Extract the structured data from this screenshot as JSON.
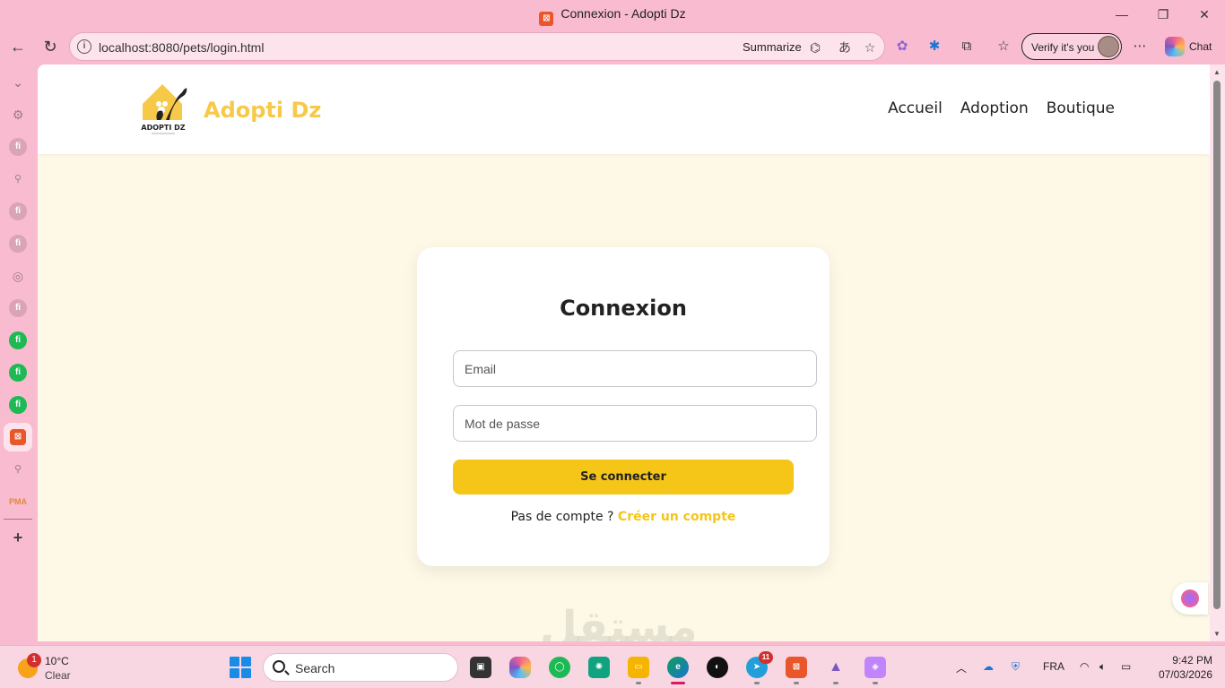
{
  "browser": {
    "window_title": "Connexion - Adopti Dz",
    "url": "localhost:8080/pets/login.html",
    "summarize_label": "Summarize",
    "verify_label": "Verify it's you",
    "chat_label": "Chat"
  },
  "site": {
    "brand": "Adopti Dz",
    "logo_text": "ADOPTI DZ",
    "nav": [
      {
        "label": "Accueil"
      },
      {
        "label": "Adoption"
      },
      {
        "label": "Boutique"
      }
    ]
  },
  "login": {
    "heading": "Connexion",
    "email_placeholder": "Email",
    "password_placeholder": "Mot de passe",
    "submit_label": "Se connecter",
    "no_account_text": "Pas de compte ?",
    "create_account_link": "Créer un compte"
  },
  "taskbar": {
    "weather_temp": "10°C",
    "weather_condition": "Clear",
    "weather_badge": "1",
    "search_label": "Search",
    "telegram_badge": "11",
    "language": "FRA",
    "time": "9:42 PM",
    "date": "07/03/2026"
  },
  "colors": {
    "brand_yellow": "#f7c948",
    "button_yellow": "#f5c518",
    "page_background": "#fef9e6",
    "browser_pink": "#f8bbd0"
  }
}
